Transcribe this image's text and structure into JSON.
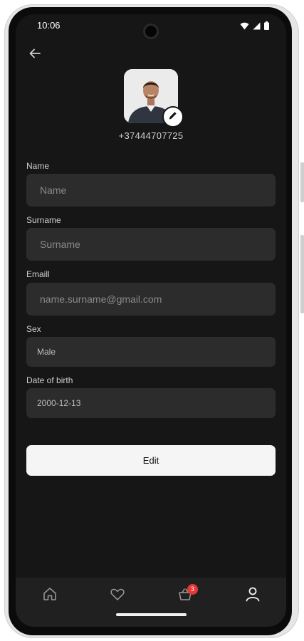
{
  "status_bar": {
    "time": "10:06",
    "icons": [
      "wifi-icon",
      "signal-icon",
      "battery-icon"
    ]
  },
  "header": {
    "back_icon": "arrow-left-icon"
  },
  "profile": {
    "phone": "+37444707725",
    "edit_avatar_icon": "pencil-icon"
  },
  "form": {
    "name": {
      "label": "Name",
      "value": "",
      "placeholder": "Name"
    },
    "surname": {
      "label": "Surname",
      "value": "",
      "placeholder": "Surname"
    },
    "email": {
      "label": "Emaill",
      "value": "",
      "placeholder": "name.surname@gmail.com"
    },
    "sex": {
      "label": "Sex",
      "value": "Male"
    },
    "dob": {
      "label": "Date of birth",
      "value": "2000-12-13"
    }
  },
  "actions": {
    "edit_label": "Edit"
  },
  "bottom_nav": {
    "items": [
      {
        "name": "home",
        "icon": "home-icon"
      },
      {
        "name": "favorites",
        "icon": "heart-icon"
      },
      {
        "name": "cart",
        "icon": "basket-icon",
        "badge": "3"
      },
      {
        "name": "profile",
        "icon": "user-icon",
        "active": true
      }
    ]
  },
  "colors": {
    "screen_bg": "#161616",
    "field_bg": "#2c2c2c",
    "button_bg": "#f5f5f5",
    "badge": "#e53935",
    "nav_bg": "#202020"
  }
}
